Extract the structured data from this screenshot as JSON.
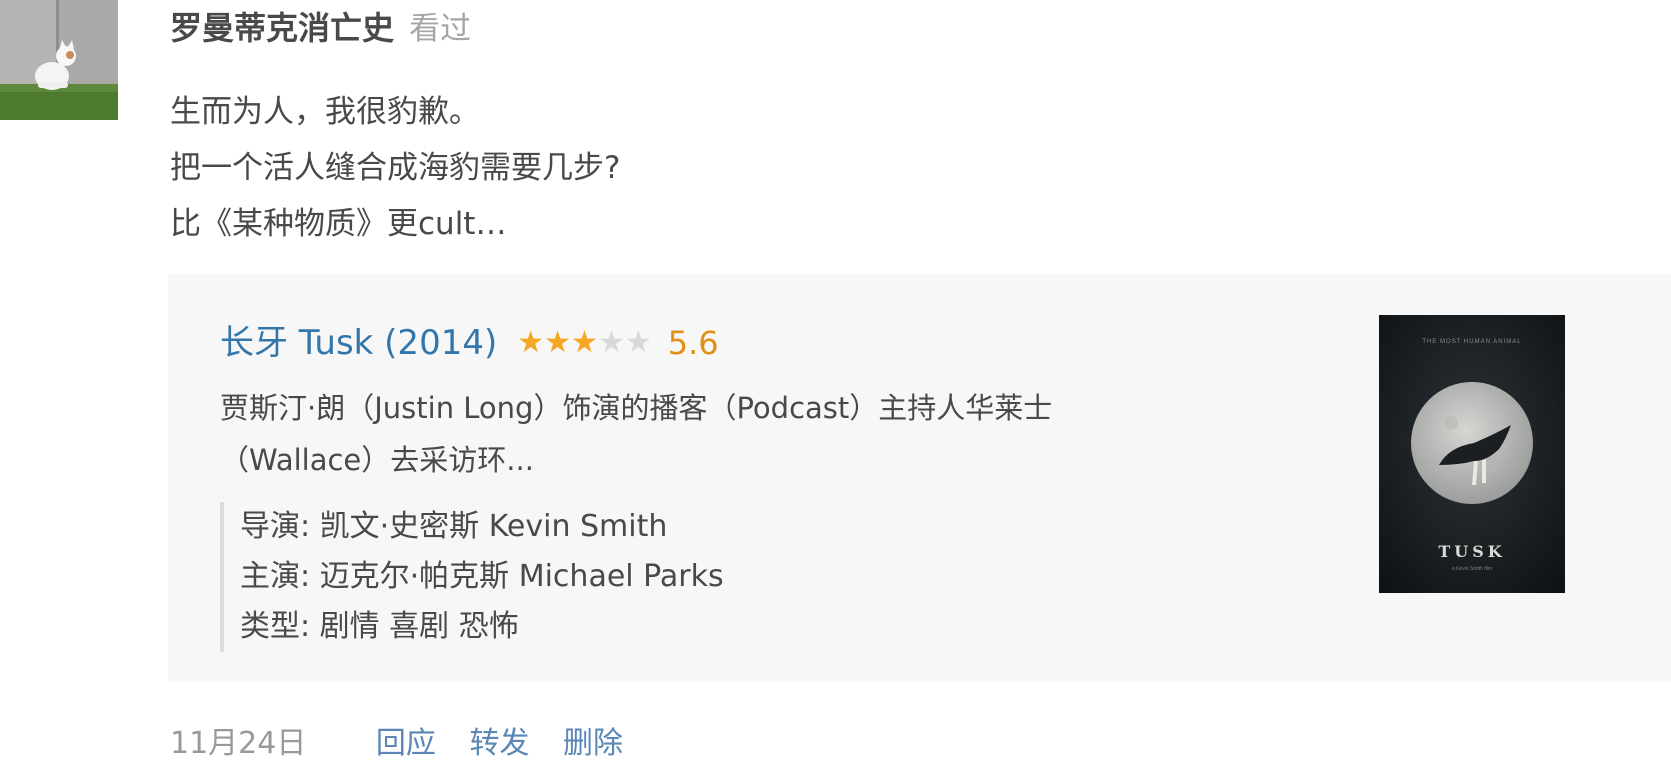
{
  "post": {
    "author_name": "罗曼蒂克消亡史",
    "status_text": "看过",
    "text_lines": [
      "生而为人，我很豹歉。",
      "把一个活人缝合成海豹需要几步?",
      "比《某种物质》更cult…"
    ]
  },
  "card": {
    "title": "长牙 Tusk (2014)",
    "rating": {
      "stars_filled": 3,
      "stars_total": 5,
      "score": "5.6",
      "star_on_color": "#f5a623",
      "star_off_color": "#d9d9d9"
    },
    "synopsis_lines": [
      "贾斯汀·朗（Justin Long）饰演的播客（Podcast）主持人华莱士",
      "（Wallace）去采访环..."
    ],
    "meta": {
      "director": "导演: 凯文·史密斯 Kevin Smith",
      "cast": "主演: 迈克尔·帕克斯 Michael Parks",
      "genre": "类型: 剧情 喜剧 恐怖"
    },
    "poster": {
      "tagline": "THE MOST HUMAN ANIMAL",
      "title": "TUSK",
      "subtitle": "a Kevin Smith film"
    }
  },
  "footer": {
    "date": "11月24日",
    "reply_label": "回应",
    "repost_label": "转发",
    "delete_label": "删除"
  },
  "colors": {
    "link": "#3377aa",
    "action": "#5b86b5",
    "card_bg": "#f7f7f7",
    "score": "#e09015"
  }
}
